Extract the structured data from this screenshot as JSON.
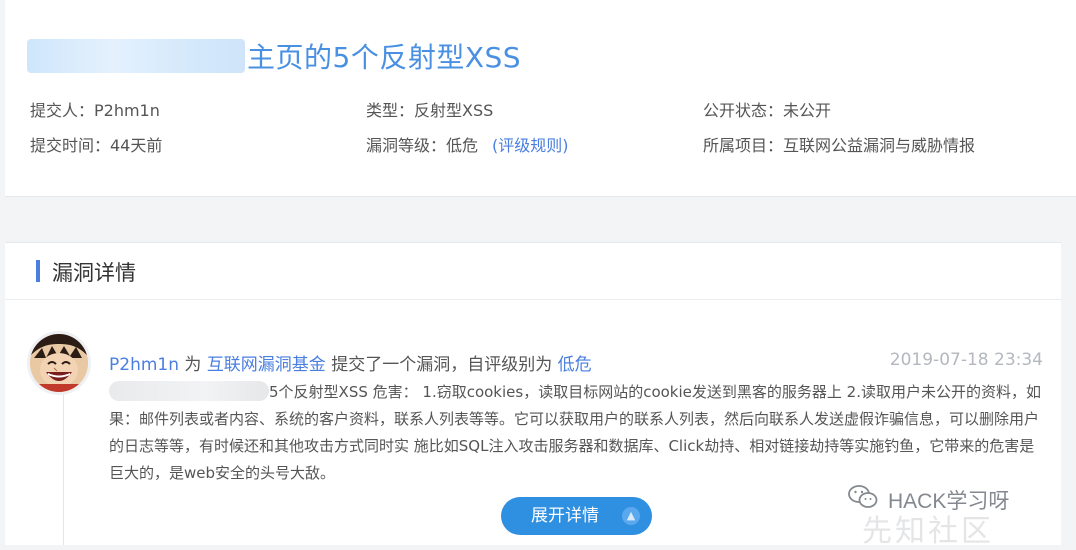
{
  "header": {
    "title_suffix": "主页的5个反射型XSS"
  },
  "meta": {
    "submitter": "提交人：P2hm1n",
    "submit_time": "提交时间：44天前",
    "type": "类型：反射型XSS",
    "level": "漏洞等级：低危",
    "rating_rule_link": "(评级规则)",
    "public_status": "公开状态：未公开",
    "project": "所属项目：互联网公益漏洞与威胁情报"
  },
  "detail_section": {
    "title": "漏洞详情",
    "entry": {
      "user": "P2hm1n",
      "word_for": "为",
      "foundation": "互联网漏洞基金",
      "action": "提交了一个漏洞，自评级别为",
      "self_rating": "低危",
      "timestamp": "2019-07-18 23:34",
      "body_text": "5个反射型XSS 危害： 1.窃取cookies，读取目标网站的cookie发送到黑客的服务器上 2.读取用户未公开的资料，如果：邮件列表或者内容、系统的客户资料，联系人列表等等。它可以获取用户的联系人列表，然后向联系人发送虚假诈骗信息，可以删除用户的日志等等，有时候还和其他攻击方式同时实 施比如SQL注入攻击服务器和数据库、Click劫持、相对链接劫持等实施钓鱼，它带来的危害是巨大的，是web安全的头号大敌。"
    },
    "expand_button": "展开详情"
  },
  "watermark": {
    "text": "HACK学习呀",
    "text2": "先知社区"
  },
  "colors": {
    "accent": "#4a7fe0",
    "title_blue": "#4a90e2",
    "button_blue": "#2f8fe0"
  }
}
